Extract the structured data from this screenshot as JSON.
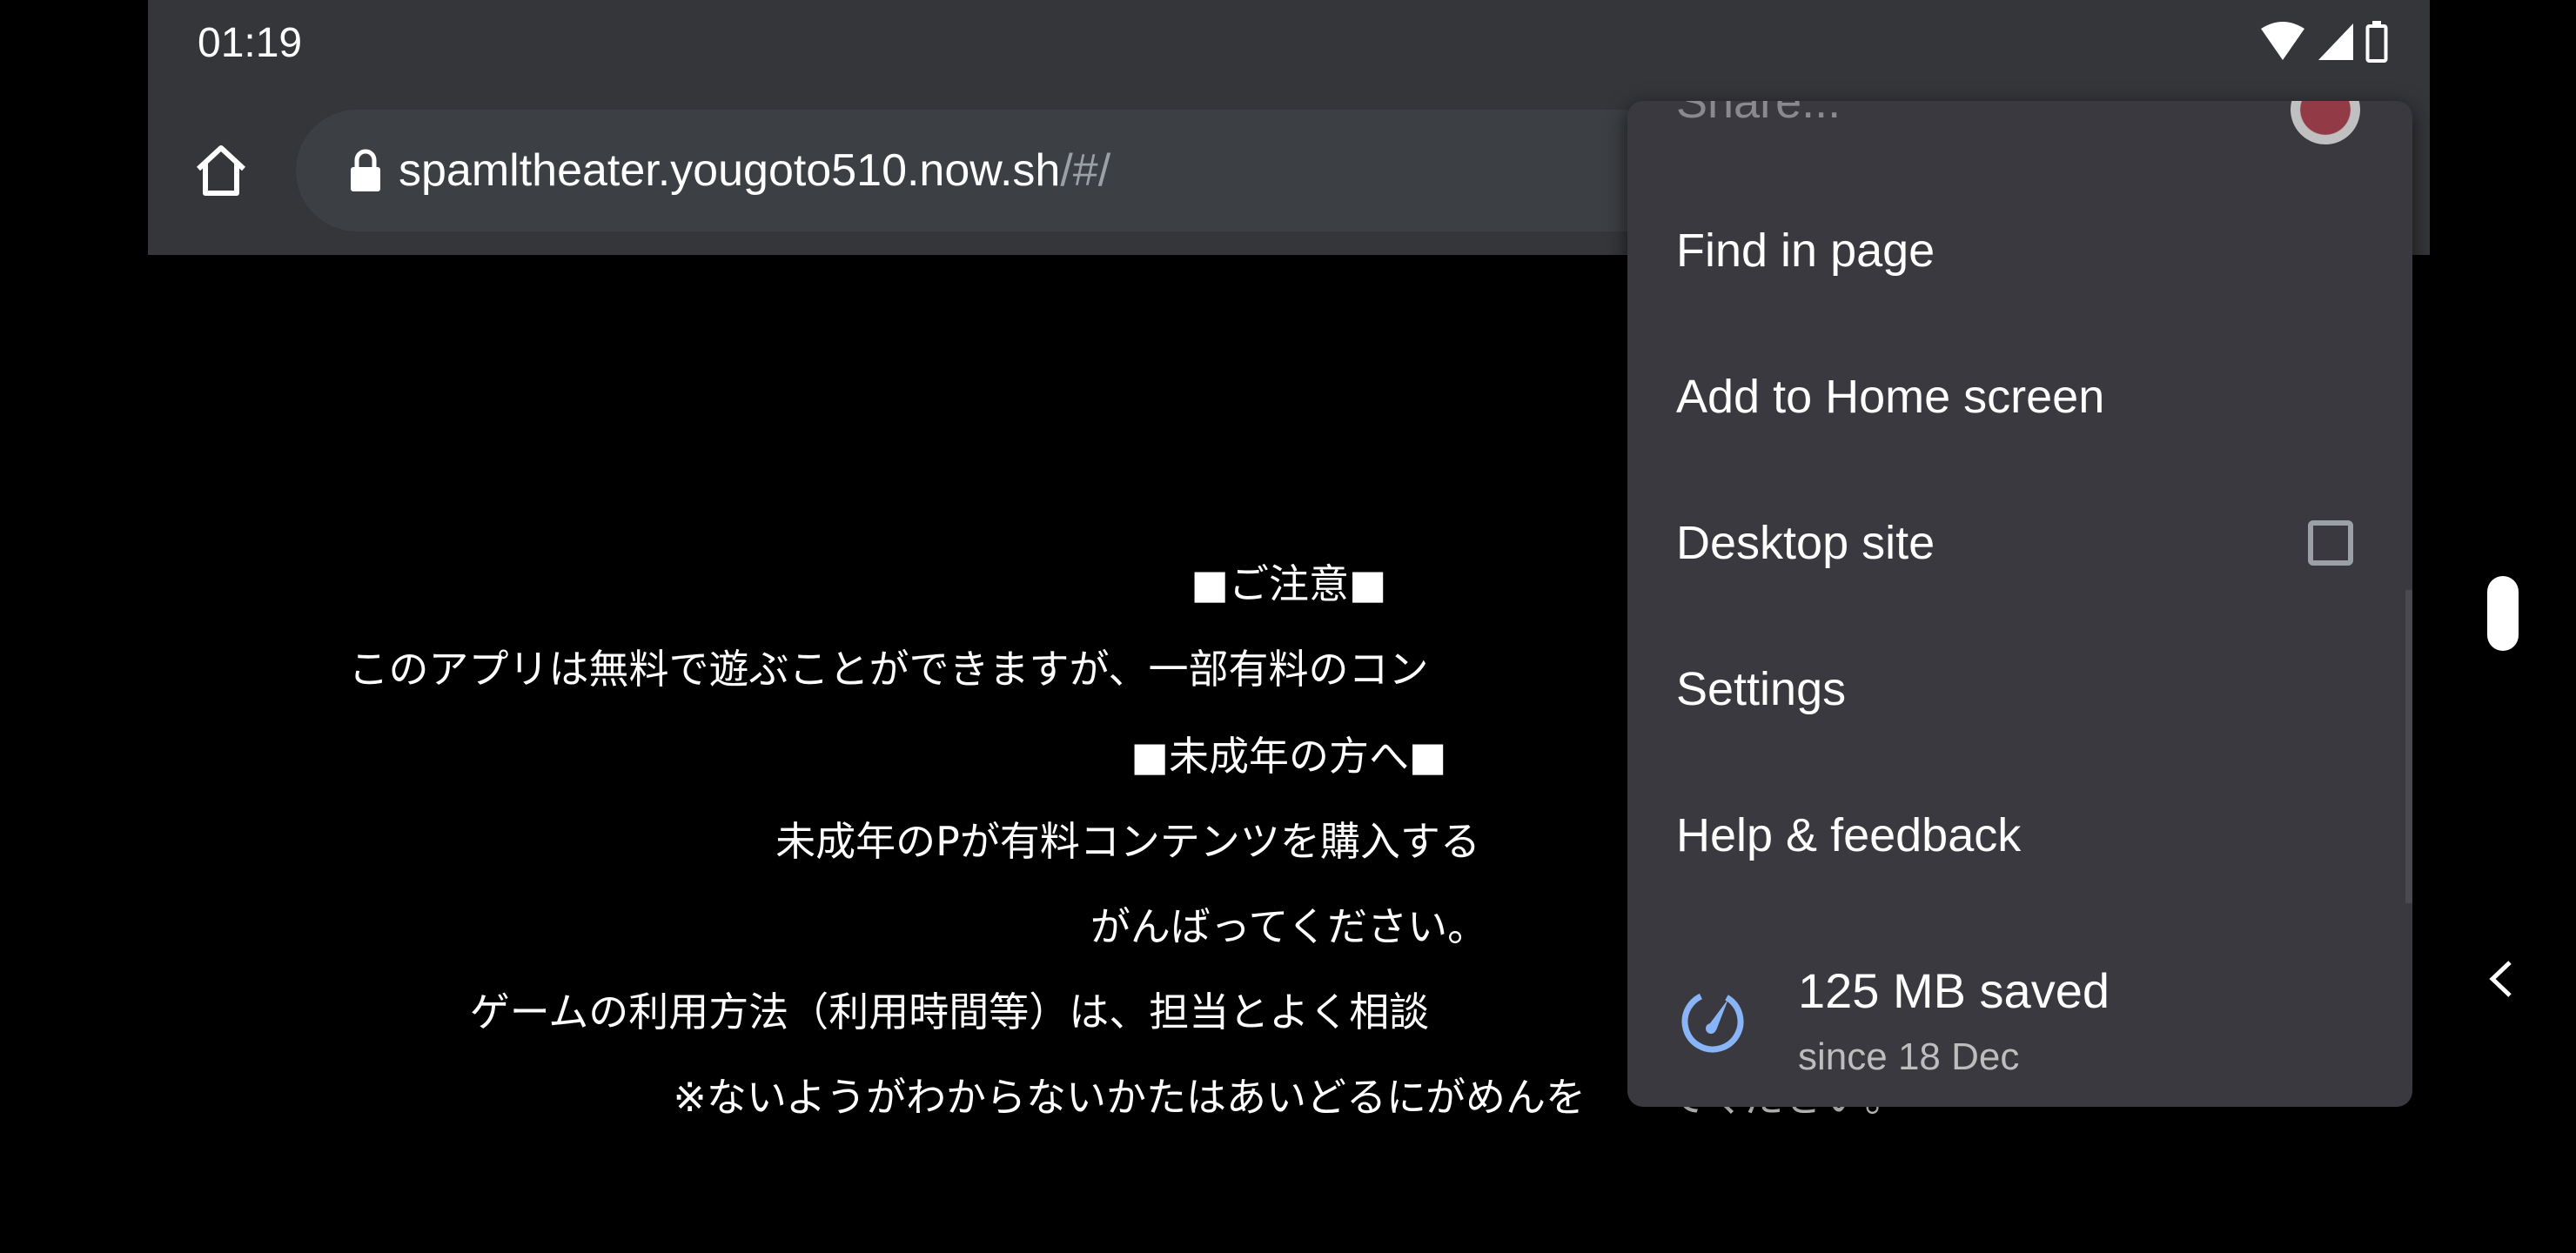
{
  "status_bar": {
    "time": "01:19",
    "icons": [
      "wifi-icon",
      "cell-signal-icon",
      "battery-icon"
    ]
  },
  "toolbar": {
    "home_icon": "home-icon",
    "lock_icon": "lock-icon",
    "url_host": "spamltheater.yougoto510.now.sh",
    "url_path": "/#/"
  },
  "page": {
    "lines": [
      "■ご注意■",
      "このアプリは無料で遊ぶことができますが、一部有料のコン",
      "■未成年の方へ■",
      "未成年のPが有料コンテンツを購入する",
      "がんばってください。",
      "ゲームの利用方法（利用時間等）は、担当とよく相談",
      "※ないようがわからないかたはあいどるにがめんを　　てください。"
    ]
  },
  "menu": {
    "items": [
      {
        "label": "Share...",
        "icon": "share-app-icon"
      },
      {
        "label": "Find in page"
      },
      {
        "label": "Add to Home screen"
      },
      {
        "label": "Desktop site",
        "checkbox": false
      },
      {
        "label": "Settings"
      },
      {
        "label": "Help & feedback"
      }
    ],
    "data_saver": {
      "icon": "speedometer-icon",
      "title": "125 MB saved",
      "subtitle": "since 18 Dec",
      "accent": "#8ab4f8"
    }
  },
  "nav": {
    "home": "home-pill",
    "back": "back-chevron-icon"
  }
}
